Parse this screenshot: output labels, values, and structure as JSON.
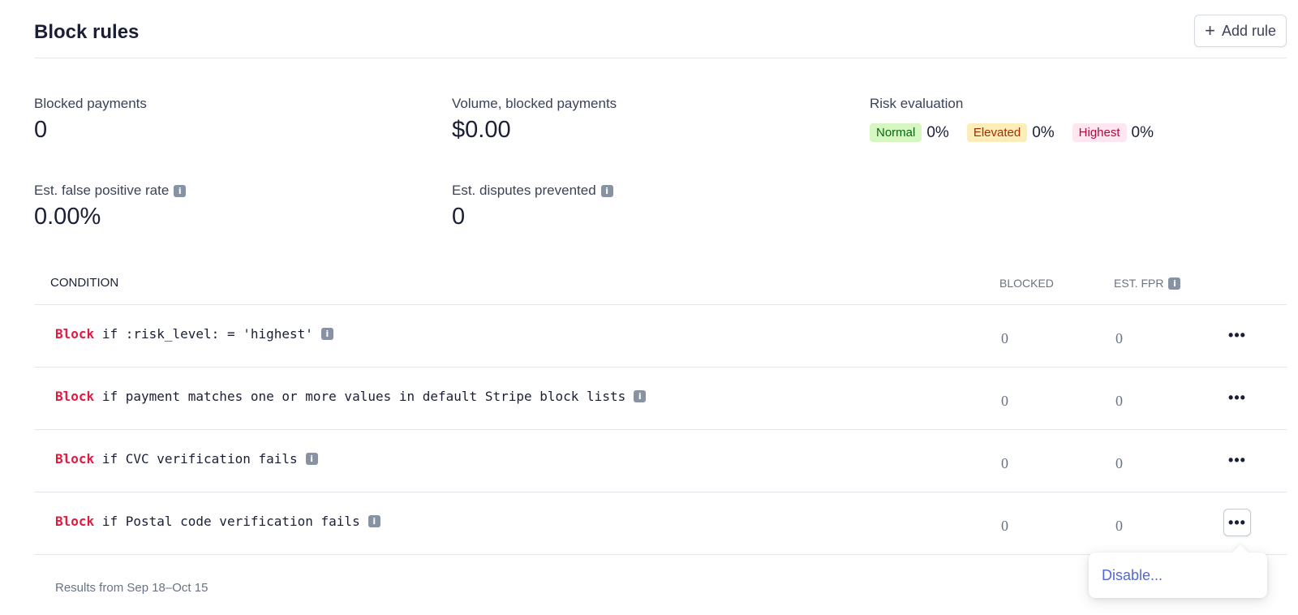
{
  "header": {
    "title": "Block rules",
    "add_rule_label": "Add rule",
    "add_rule_icon": "plus-icon"
  },
  "stats": {
    "blocked_payments": {
      "label": "Blocked payments",
      "value": "0"
    },
    "volume_blocked": {
      "label": "Volume, blocked payments",
      "value": "$0.00"
    },
    "false_positive_rate": {
      "label": "Est. false positive rate",
      "value": "0.00%"
    },
    "disputes_prevented": {
      "label": "Est. disputes prevented",
      "value": "0"
    }
  },
  "risk": {
    "label": "Risk evaluation",
    "levels": [
      {
        "name": "Normal",
        "value": "0%",
        "color": "#d7f7c2"
      },
      {
        "name": "Elevated",
        "value": "0%",
        "color": "#fcedb9"
      },
      {
        "name": "Highest",
        "value": "0%",
        "color": "#ffe7f2"
      }
    ]
  },
  "table": {
    "headers": {
      "condition": "CONDITION",
      "blocked": "BLOCKED",
      "est_fpr": "EST. FPR"
    },
    "rows": [
      {
        "action": "Block",
        "condition": "if :risk_level: = 'highest'",
        "blocked": "0",
        "est_fpr": "0"
      },
      {
        "action": "Block",
        "condition": "if payment matches one or more values in default Stripe block lists",
        "blocked": "0",
        "est_fpr": "0"
      },
      {
        "action": "Block",
        "condition": "if CVC verification fails",
        "blocked": "0",
        "est_fpr": "0"
      },
      {
        "action": "Block",
        "condition": "if Postal code verification fails",
        "blocked": "0",
        "est_fpr": "0"
      }
    ],
    "more_icon": "ellipsis-icon"
  },
  "footer": {
    "note": "Results from Sep 18–Oct 15"
  },
  "popover": {
    "item": "Disable..."
  },
  "colors": {
    "block_keyword": "#df1b41",
    "link": "#5469d4",
    "info_icon": "#8792a2"
  }
}
